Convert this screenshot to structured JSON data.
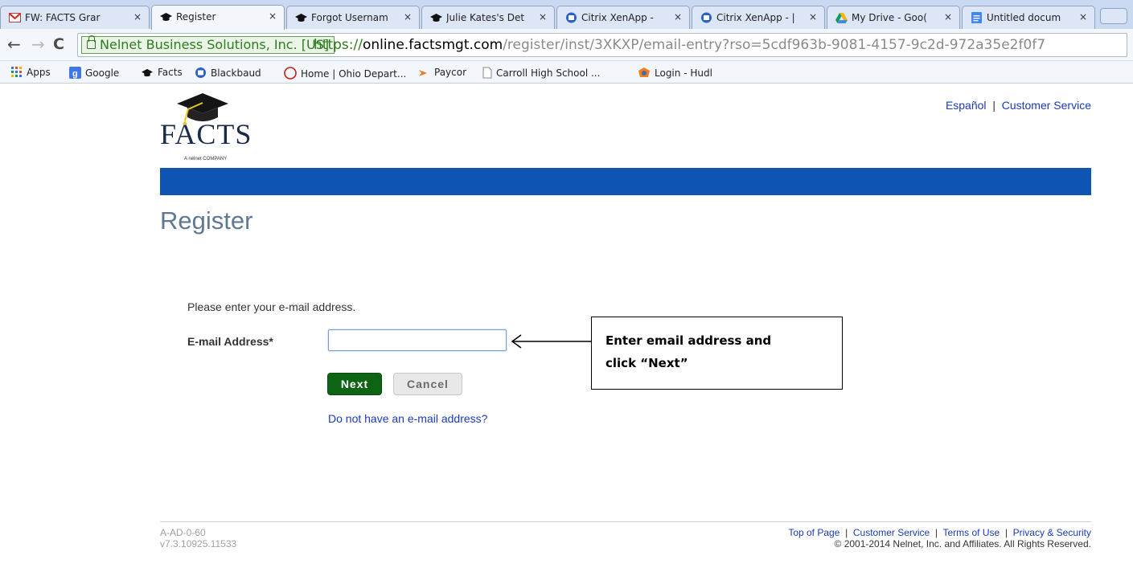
{
  "browser": {
    "tabs": [
      {
        "title": "FW: FACTS Grar",
        "icon": "gmail-icon"
      },
      {
        "title": "Register",
        "icon": "graduation-cap-icon"
      },
      {
        "title": "Forgot Usernam",
        "icon": "graduation-cap-icon"
      },
      {
        "title": "Julie Kates's Det",
        "icon": "graduation-cap-icon"
      },
      {
        "title": "Citrix XenApp -",
        "icon": "citrix-icon"
      },
      {
        "title": "Citrix XenApp - |",
        "icon": "citrix-icon"
      },
      {
        "title": "My Drive - Goo(",
        "icon": "google-drive-icon"
      },
      {
        "title": "Untitled docum",
        "icon": "google-docs-icon"
      }
    ],
    "tab_close": "×",
    "address": {
      "ev_label": "Nelnet Business Solutions, Inc. [US]",
      "scheme": "https://",
      "host": "online.factsmgt.com",
      "path": "/register/inst/3XKXP/email-entry?rso=5cdf963b-9081-4157-9c2d-972a35e2f0f7"
    },
    "bookmarks": [
      {
        "label": "Apps",
        "icon": "apps-grid-icon"
      },
      {
        "label": "Google",
        "icon": "google-icon"
      },
      {
        "label": "Facts",
        "icon": "graduation-cap-icon"
      },
      {
        "label": "Blackbaud",
        "icon": "citrix-icon"
      },
      {
        "label": "Home | Ohio Depart...",
        "icon": "ohio-icon"
      },
      {
        "label": "Paycor",
        "icon": "paycor-icon"
      },
      {
        "label": "Carroll High School ...",
        "icon": "page-icon"
      },
      {
        "label": "Login - Hudl",
        "icon": "hudl-icon"
      }
    ]
  },
  "page": {
    "logo": {
      "text": "FACTS",
      "subtext": "A nelnet COMPANY"
    },
    "top_links": {
      "espanol": "Español",
      "separator": "|",
      "customer_service": "Customer Service"
    },
    "title": "Register",
    "prompt": "Please enter your e-mail address.",
    "email_label": "E-mail Address*",
    "email_value": "",
    "next_label": "Next",
    "cancel_label": "Cancel",
    "no_email_link": "Do not have an e-mail address?",
    "annotation": {
      "line1": "Enter email address and",
      "line2": "click “Next”"
    },
    "footer": {
      "code": "A-AD-0-60",
      "version": "v7.3.10925.11533",
      "links": [
        "Top of Page",
        "Customer Service",
        "Terms of Use",
        "Privacy & Security"
      ],
      "separator": "|",
      "copyright": "© 2001-2014 Nelnet, Inc. and Affiliates. All Rights Reserved."
    },
    "colors": {
      "banner": "#0d54b3",
      "title": "#5f7894",
      "next_button": "#0e6415",
      "link": "#1a3bb8"
    }
  }
}
